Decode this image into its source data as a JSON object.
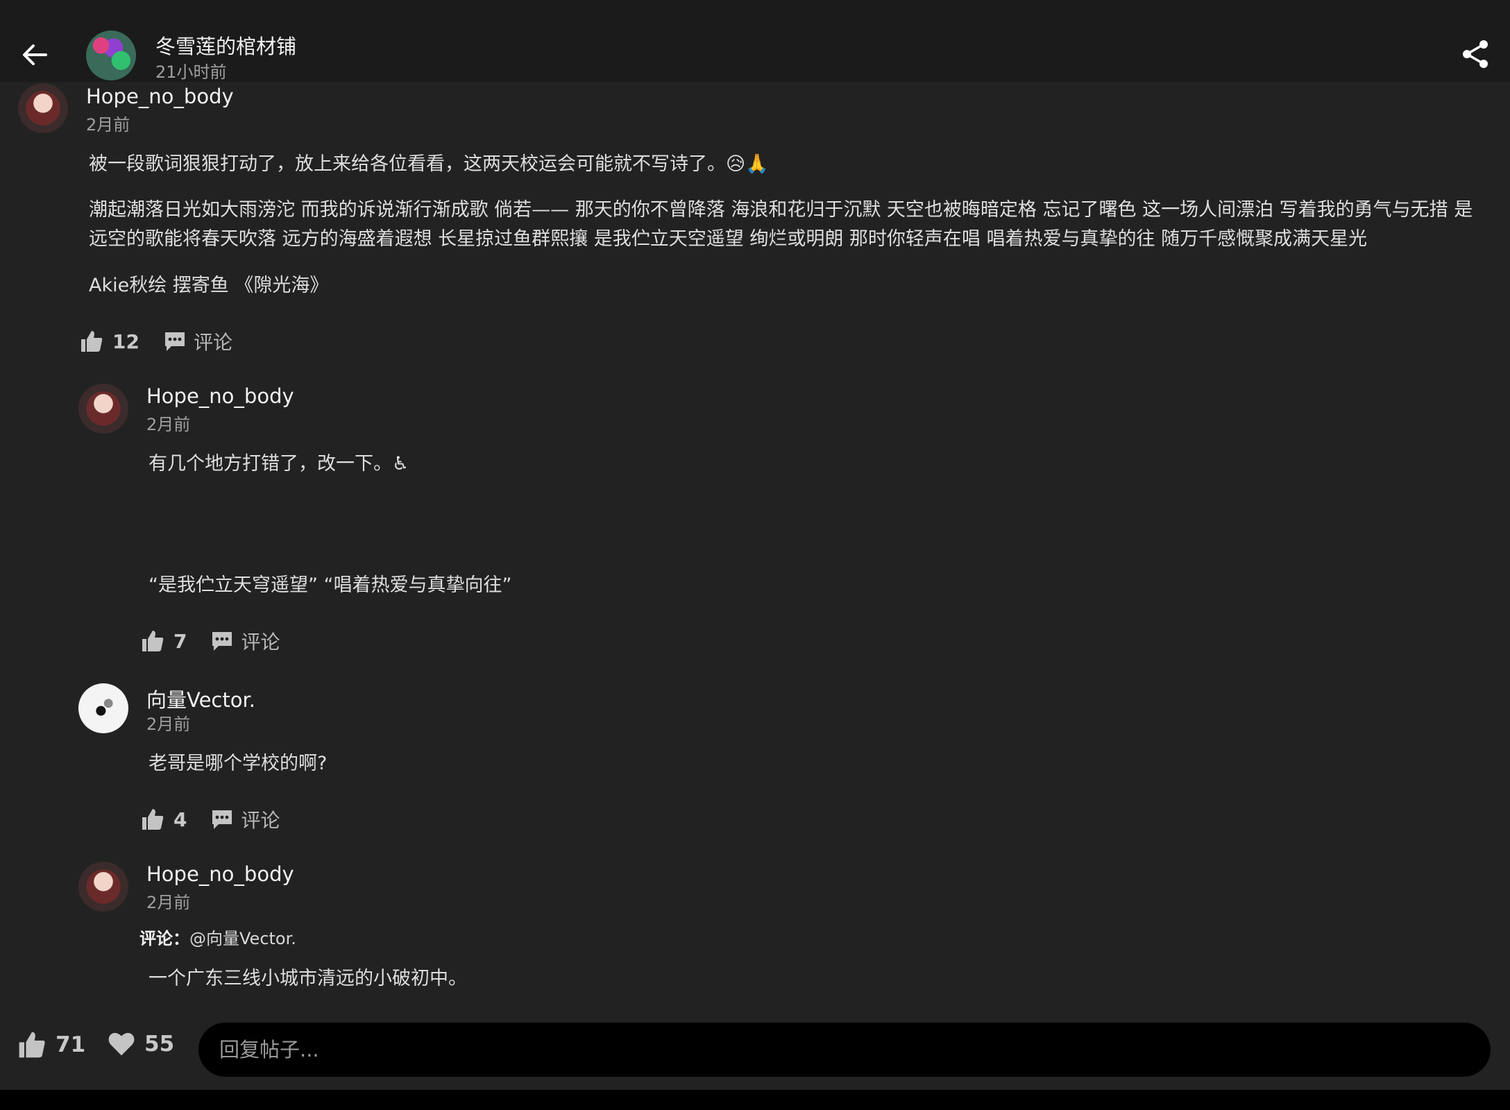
{
  "header": {
    "title": "冬雪莲的棺材铺",
    "time": "21小时前"
  },
  "post": {
    "author": "Hope_no_body",
    "time": "2月前",
    "paragraphs": [
      "被一段歌词狠狠打动了，放上来给各位看看，这两天校运会可能就不写诗了。😥🙏",
      "潮起潮落日光如大雨滂沱 而我的诉说渐行渐成歌 倘若—— 那天的你不曾降落 海浪和花归于沉默 天空也被晦暗定格 忘记了曙色 这一场人间漂泊 写着我的勇气与无措 是远空的歌能将春天吹落 远方的海盛着遐想 长星掠过鱼群熙攘 是我伫立天空遥望 绚烂或明朗 那时你轻声在唱 唱着热爱与真挚的往 随万千感慨聚成满天星光",
      "Akie秋绘 摆寄鱼 《隙光海》"
    ],
    "likes": "12",
    "comment_label": "评论"
  },
  "comments": [
    {
      "author": "Hope_no_body",
      "time": "2月前",
      "text1": "有几个地方打错了，改一下。♿",
      "text2": "“是我伫立天穹遥望” “唱着热爱与真挚向往”",
      "likes": "7",
      "comment_label": "评论"
    },
    {
      "author": "向量Vector.",
      "time": "2月前",
      "text1": "老哥是哪个学校的啊?",
      "likes": "4",
      "comment_label": "评论"
    },
    {
      "author": "Hope_no_body",
      "time": "2月前",
      "reply_prefix": "评论：",
      "reply_to": "@向量Vector.",
      "text1": "一个广东三线小城市清远的小破初中。"
    }
  ],
  "footer": {
    "likes": "71",
    "favorites": "55",
    "reply_placeholder": "回复帖子..."
  },
  "icons": {
    "back": "back-arrow-icon",
    "share": "share-icon",
    "like": "thumbs-up-icon",
    "comment": "comment-bubble-icon",
    "favorite": "heart-icon"
  },
  "colors": {
    "background": "#222222",
    "header": "#1b1b1b",
    "input": "#000000"
  }
}
